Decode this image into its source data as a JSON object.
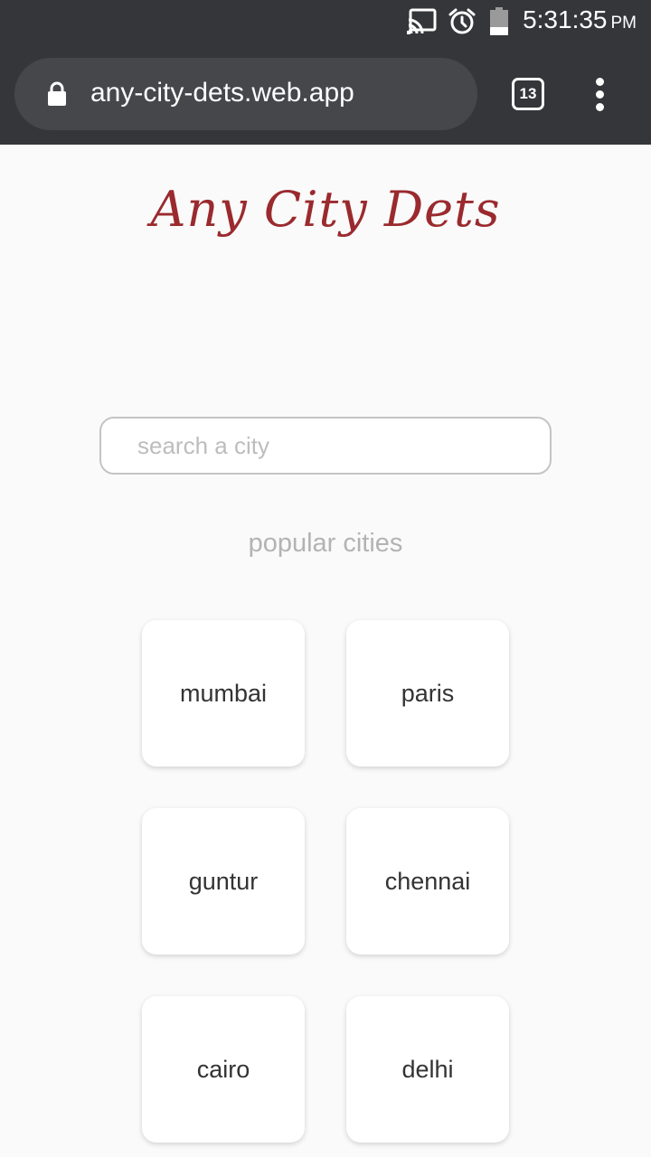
{
  "status_bar": {
    "time": "5:31:35",
    "ampm": "PM",
    "icons": [
      "cast-icon",
      "alarm-icon",
      "battery-icon"
    ]
  },
  "browser": {
    "url": "any-city-dets.web.app",
    "tab_count": "13",
    "icons": [
      "lock-icon",
      "menu-icon"
    ]
  },
  "app": {
    "title": "Any City Dets",
    "title_color": "#9a2a2e",
    "search_placeholder": "search a city",
    "popular_label": "popular cities",
    "cities": [
      "mumbai",
      "paris",
      "guntur",
      "chennai",
      "cairo",
      "delhi"
    ]
  }
}
